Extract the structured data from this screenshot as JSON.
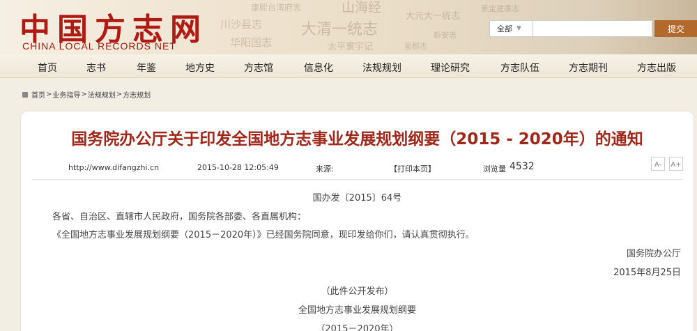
{
  "site": {
    "logo_cn": "中国方志网",
    "logo_en": "CHINA LOCAL RECORDS NET",
    "deco_texts": [
      "川沙县志",
      "华阳国志",
      "大清一统志",
      "太平寰宇记",
      "山海经",
      "大元大一统志",
      "新安志",
      "吴郡志",
      "景定建康志",
      "康熙台湾府志"
    ]
  },
  "search": {
    "scope": "全部",
    "placeholder": "",
    "button_label": "提交"
  },
  "nav": {
    "items": [
      {
        "label": "首页"
      },
      {
        "label": "志书"
      },
      {
        "label": "年鉴"
      },
      {
        "label": "地方史"
      },
      {
        "label": "方志馆"
      },
      {
        "label": "信息化"
      },
      {
        "label": "法规规划"
      },
      {
        "label": "理论研究"
      },
      {
        "label": "方志队伍"
      },
      {
        "label": "方志期刊"
      },
      {
        "label": "方志出版"
      }
    ]
  },
  "breadcrumb": [
    "首页",
    "业务指导",
    "法规规划",
    "方志规划"
  ],
  "breadcrumb_sep": ">",
  "article": {
    "title": "国务院办公厅关于印发全国地方志事业发展规划纲要（2015 - 2020年）的通知",
    "source_url": "http://www.difangzhi.cn",
    "datetime": "2015-10-28 12:05:49",
    "source_label": "来源:",
    "print_label": "【打印本页】",
    "views_label": "浏览量",
    "views": "4532",
    "font_decrease": "A-",
    "font_increase": "A+",
    "doc_number": "国办发〔2015〕64号",
    "addressee": "各省、自治区、直辖市人民政府，国务院各部委、各直属机构：",
    "paragraph": "《全国地方志事业发展规划纲要（2015－2020年）》已经国务院同意，现印发给你们，请认真贯彻执行。",
    "signatory": "国务院办公厅",
    "sign_date": "2015年8月25日",
    "publish_note": "（此件公开发布）",
    "sub_title": "全国地方志事业发展规划纲要",
    "sub_years": "（2015－2020年）"
  }
}
